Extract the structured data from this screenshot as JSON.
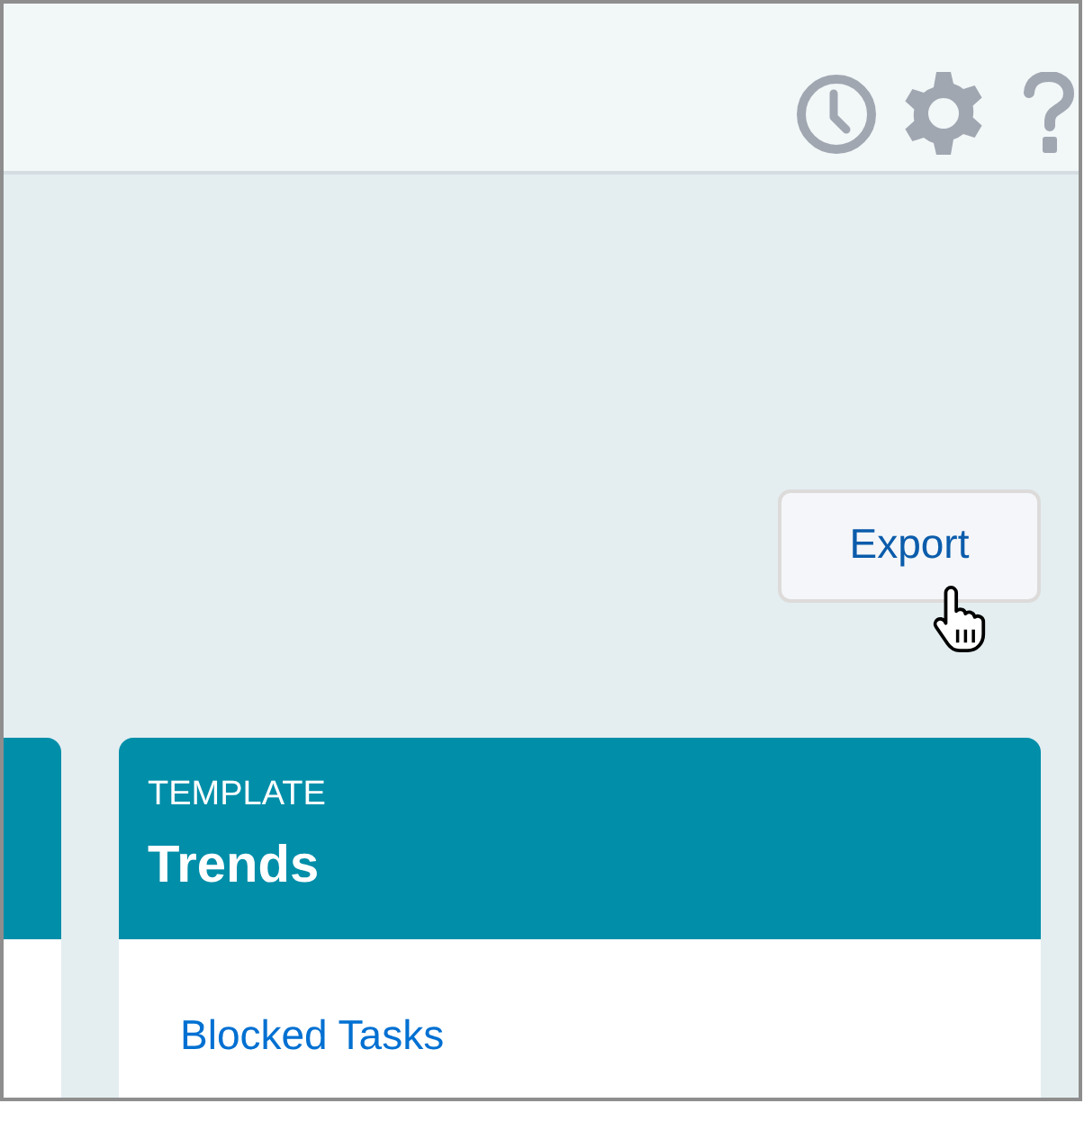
{
  "export_button": {
    "label": "Export"
  },
  "cards": [
    {
      "kind": "partial"
    },
    {
      "kind": "template",
      "label": "TEMPLATE",
      "title": "Trends",
      "links": [
        "Blocked Tasks"
      ]
    }
  ]
}
